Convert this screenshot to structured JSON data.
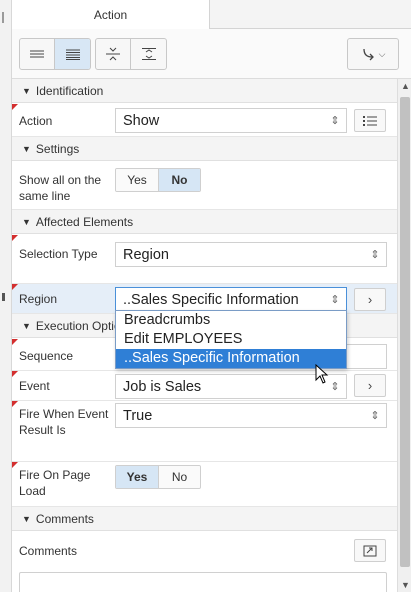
{
  "tabs": {
    "action": "Action"
  },
  "toolbar": {
    "buttons": [
      "lines-icon",
      "dense-lines-icon",
      "collapse-icon",
      "expand-icon"
    ],
    "go_button": "redirect-arrow-icon"
  },
  "sections": {
    "identification": "Identification",
    "settings": "Settings",
    "affected_elements": "Affected Elements",
    "execution_options": "Execution Options",
    "comments": "Comments"
  },
  "fields": {
    "action_label": "Action",
    "action_value": "Show",
    "show_all_label": "Show all on the same line",
    "show_all_yes": "Yes",
    "show_all_no": "No",
    "selection_type_label": "Selection Type",
    "selection_type_value": "Region",
    "region_label": "Region",
    "region_value": "..Sales Specific Information",
    "sequence_label": "Sequence",
    "event_label": "Event",
    "event_value": "Job is Sales",
    "fire_when_label": "Fire When Event Result Is",
    "fire_when_value": "True",
    "fire_on_load_label": "Fire On Page Load",
    "fire_on_load_yes": "Yes",
    "fire_on_load_no": "No",
    "comments_label": "Comments"
  },
  "region_dropdown": {
    "options": [
      "Breadcrumbs",
      "Edit EMPLOYEES",
      "..Sales Specific Information"
    ],
    "highlighted": 2
  }
}
